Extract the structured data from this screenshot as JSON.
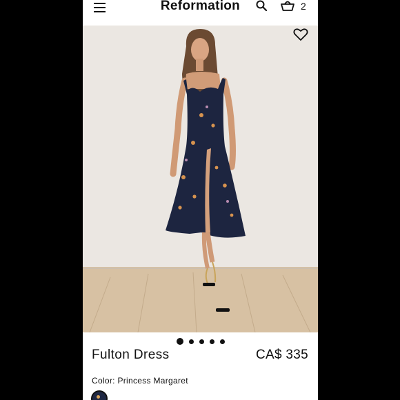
{
  "header": {
    "brand": "Reformation",
    "menu_icon": "hamburger-menu-icon",
    "search_icon": "search-icon",
    "cart_icon": "shopping-basket-icon",
    "cart_count": "2"
  },
  "gallery": {
    "favorite_icon": "heart-icon",
    "image_count": 5,
    "active_index": 0
  },
  "product": {
    "name": "Fulton Dress",
    "price": "CA$ 335",
    "color_label": "Color: Princess Margaret",
    "swatch_color": "#1e2743"
  },
  "colors": {
    "accent": "#111111",
    "background": "#ffffff",
    "frame": "#000000"
  }
}
